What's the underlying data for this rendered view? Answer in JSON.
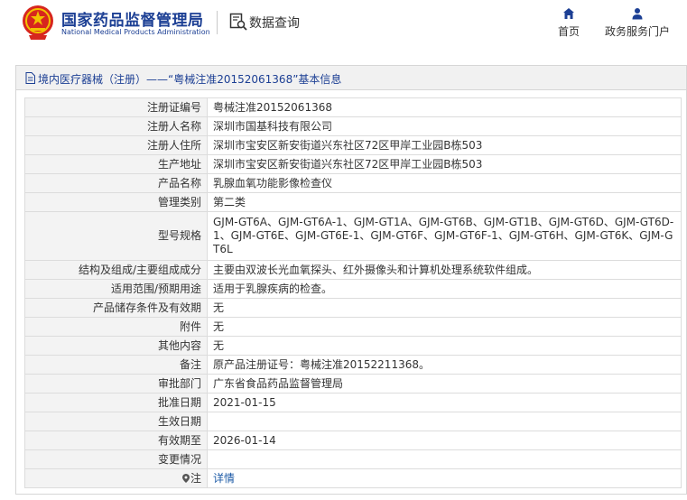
{
  "header": {
    "brand_cn": "国家药品监督管理局",
    "brand_en": "National Medical Products Administration",
    "data_query": "数据查询",
    "nav_home": "首页",
    "nav_portal": "政务服务门户"
  },
  "breadcrumb": {
    "text": "境内医疗器械（注册）——“粤械注准20152061368”基本信息"
  },
  "rows": [
    {
      "label": "注册证编号",
      "value": "粤械注准20152061368"
    },
    {
      "label": "注册人名称",
      "value": "深圳市国基科技有限公司"
    },
    {
      "label": "注册人住所",
      "value": "深圳市宝安区新安街道兴东社区72区甲岸工业园B栋503"
    },
    {
      "label": "生产地址",
      "value": "深圳市宝安区新安街道兴东社区72区甲岸工业园B栋503"
    },
    {
      "label": "产品名称",
      "value": "乳腺血氧功能影像检查仪"
    },
    {
      "label": "管理类别",
      "value": "第二类"
    },
    {
      "label": "型号规格",
      "value": "GJM-GT6A、GJM-GT6A-1、GJM-GT1A、GJM-GT6B、GJM-GT1B、GJM-GT6D、GJM-GT6D-1、GJM-GT6E、GJM-GT6E-1、GJM-GT6F、GJM-GT6F-1、GJM-GT6H、GJM-GT6K、GJM-GT6L"
    },
    {
      "label": "结构及组成/主要组成成分",
      "value": "主要由双波长光血氧探头、红外摄像头和计算机处理系统软件组成。"
    },
    {
      "label": "适用范围/预期用途",
      "value": "适用于乳腺疾病的检查。"
    },
    {
      "label": "产品储存条件及有效期",
      "value": "无"
    },
    {
      "label": "附件",
      "value": "无"
    },
    {
      "label": "其他内容",
      "value": "无"
    },
    {
      "label": "备注",
      "value": "原产品注册证号：粤械注准20152211368。"
    },
    {
      "label": "审批部门",
      "value": "广东省食品药品监督管理局"
    },
    {
      "label": "批准日期",
      "value": "2021-01-15"
    },
    {
      "label": "生效日期",
      "value": ""
    },
    {
      "label": "有效期至",
      "value": "2026-01-14"
    },
    {
      "label": "变更情况",
      "value": ""
    },
    {
      "label": "注",
      "value": "详情"
    }
  ],
  "colors": {
    "brand_blue": "#1c3f94",
    "emblem_red": "#d7261e",
    "emblem_gold": "#f2c200",
    "link_blue": "#1c5aa6"
  }
}
